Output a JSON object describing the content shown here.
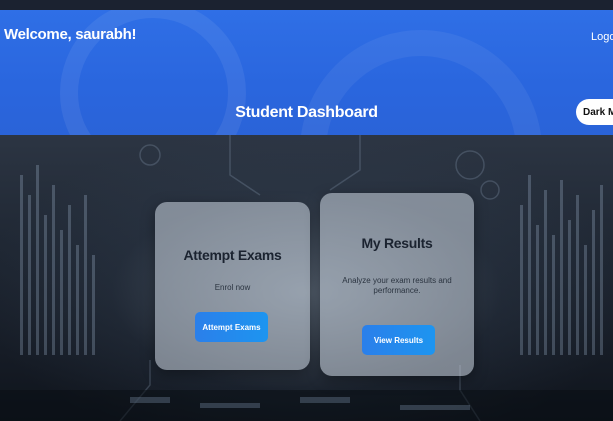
{
  "header": {
    "welcome": "Welcome, saurabh!",
    "logout_label": "Logo",
    "title": "Student Dashboard",
    "dark_mode_label": "Dark Mo"
  },
  "cards": {
    "exams": {
      "title": "Attempt Exams",
      "description": "Enrol now",
      "button_label": "Attempt Exams"
    },
    "results": {
      "title": "My Results",
      "description": "Analyze your exam results and performance.",
      "button_label": "View Results"
    }
  },
  "colors": {
    "header_blue": "#2f6fe6",
    "button_blue": "#1d8ff0",
    "card_bg": "#cdd7e1"
  }
}
